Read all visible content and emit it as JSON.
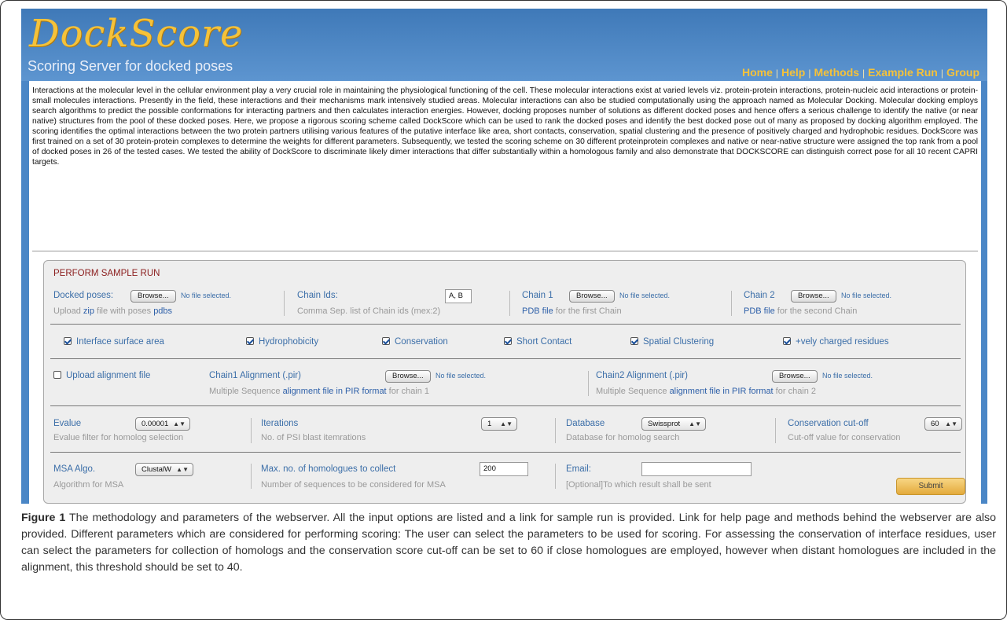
{
  "site": {
    "logo": "DockScore",
    "tagline": "Scoring Server for docked poses",
    "nav": [
      "Home",
      "Help",
      "Methods",
      "Example Run",
      "Group"
    ],
    "nav_sep": "|"
  },
  "intro": "Interactions at the molecular level in the cellular environment play a very crucial role in maintaining the physiological functioning of the cell. These molecular interactions exist at varied levels viz. protein-protein interactions, protein-nucleic acid interactions or protein-small molecules interactions. Presently in the field, these interactions and their mechanisms mark intensively studied areas. Molecular interactions can also be studied computationally using the approach named as Molecular Docking. Molecular docking employs search algorithms to predict the possible conformations for interacting partners and then calculates interaction energies. However, docking proposes number of solutions as different docked poses and hence offers a serious challenge to identify the native (or near native) structures from the pool of these docked poses. Here, we propose a rigorous scoring scheme called DockScore which can be used to rank the docked poses and identify the best docked pose out of many as proposed by docking algorithm employed. The scoring identifies the optimal interactions between the two protein partners utilising various features of the putative interface like area, short contacts, conservation, spatial clustering and the presence of positively charged and hydrophobic residues. DockScore was first trained on a set of 30 protein-protein complexes to determine the weights for different parameters. Subsequently, we tested the scoring scheme on 30 different proteinprotein complexes and native or near-native structure were assigned the top rank from a pool of docked poses in 26 of the tested cases. We tested the ability of DockScore to discriminate likely dimer interactions that differ substantially within a homologous family and also demonstrate that DOCKSCORE can distinguish correct pose for all 10 recent CAPRI targets.",
  "form": {
    "title": "PERFORM SAMPLE RUN",
    "browse_label": "Browse...",
    "no_file": "No file selected.",
    "docked": {
      "label": "Docked poses:",
      "help_pre": "Upload ",
      "help_link1": "zip",
      "help_mid": " file with poses ",
      "help_link2": "pdbs"
    },
    "chain_ids": {
      "label": "Chain Ids:",
      "value": "A, B",
      "help": "Comma Sep. list of Chain ids (mex:2)"
    },
    "chain1": {
      "label": "Chain 1",
      "help_link": "PDB file",
      "help_rest": " for the first Chain"
    },
    "chain2": {
      "label": "Chain 2",
      "help_link": "PDB file",
      "help_rest": " for the second Chain"
    },
    "checkboxes": [
      {
        "label": "Interface surface area",
        "checked": true
      },
      {
        "label": "Hydrophobicity",
        "checked": true
      },
      {
        "label": "Conservation",
        "checked": true
      },
      {
        "label": "Short Contact",
        "checked": true
      },
      {
        "label": "Spatial Clustering",
        "checked": true
      },
      {
        "label": "+vely charged residues",
        "checked": true
      }
    ],
    "upload_alignment": {
      "label": "Upload alignment file",
      "checked": false
    },
    "chain1_alignment": {
      "label": "Chain1 Alignment (.pir)",
      "help_pre": "Multiple Sequence ",
      "help_link": "alignment file in PIR format",
      "help_rest": " for chain 1"
    },
    "chain2_alignment": {
      "label": "Chain2 Alignment (.pir)",
      "help_pre": "Multiple Sequence ",
      "help_link": "alignment file in PIR format",
      "help_rest": " for chain 2"
    },
    "evalue": {
      "label": "Evalue",
      "value": "0.00001",
      "help": "Evalue filter for homolog selection"
    },
    "iterations": {
      "label": "Iterations",
      "value": "1",
      "help": "No. of PSI blast itemrations"
    },
    "database": {
      "label": "Database",
      "value": "Swissprot",
      "help": "Database for homolog search"
    },
    "conservation_cutoff": {
      "label": "Conservation cut-off",
      "value": "60",
      "help": "Cut-off value for conservation"
    },
    "msa_algo": {
      "label": "MSA Algo.",
      "value": "ClustalW",
      "help": "Algorithm for MSA"
    },
    "max_homologues": {
      "label": "Max. no. of homologues to collect",
      "value": "200",
      "help": "Number of sequences to be considered for MSA"
    },
    "email": {
      "label": "Email:",
      "value": "",
      "help": "[Optional]To which result shall be sent"
    },
    "submit": "Submit"
  },
  "caption": {
    "fig": "Figure 1",
    "text": " The methodology and parameters of the webserver. All the input options are listed and a link for sample run is provided. Link for help page and methods behind the webserver are also provided. Different parameters which are considered for performing scoring: The user can select the parameters to be used for scoring. For assessing the conservation of interface residues, user can select the parameters for collection of homologs and the conservation score cut-off can be set to 60 if close homologues are employed, however when distant homologues are included in the alignment, this threshold should be set to 40."
  },
  "colors": {
    "header_blue": "#4a86c6",
    "logo_gold": "#f5c23a",
    "label_blue": "#3b6ea8",
    "title_red": "#8a1c1c",
    "submit_gold": "#e3aa3c"
  }
}
